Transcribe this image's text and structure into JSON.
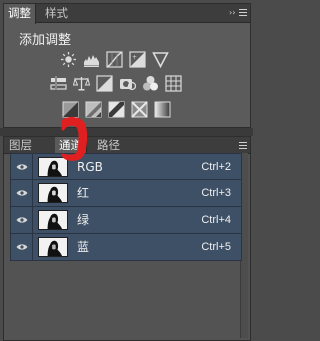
{
  "adjustments_panel": {
    "tabs": [
      {
        "label": "调整",
        "active": true
      },
      {
        "label": "样式",
        "active": false
      }
    ],
    "section_title": "添加调整",
    "icons_row1": [
      "brightness-contrast-icon",
      "levels-icon",
      "curves-icon",
      "exposure-icon",
      "vibrance-icon"
    ],
    "icons_row2": [
      "hue-saturation-icon",
      "color-balance-icon",
      "black-white-icon",
      "photo-filter-icon",
      "channel-mixer-icon",
      "color-lookup-icon"
    ],
    "icons_row3": [
      "invert-icon",
      "posterize-icon",
      "threshold-icon",
      "selective-color-icon",
      "gradient-map-icon"
    ]
  },
  "channels_panel": {
    "tabs": [
      {
        "label": "图层",
        "active": false
      },
      {
        "label": "通道",
        "active": true
      },
      {
        "label": "路径",
        "active": false
      }
    ],
    "channels": [
      {
        "name": "RGB",
        "shortcut": "Ctrl+2"
      },
      {
        "name": "红",
        "shortcut": "Ctrl+3"
      },
      {
        "name": "绿",
        "shortcut": "Ctrl+4"
      },
      {
        "name": "蓝",
        "shortcut": "Ctrl+5"
      }
    ]
  },
  "colors": {
    "panel_bg": "#5b5b5b",
    "selected_row": "#3e5066",
    "annotation": "#e02020"
  }
}
